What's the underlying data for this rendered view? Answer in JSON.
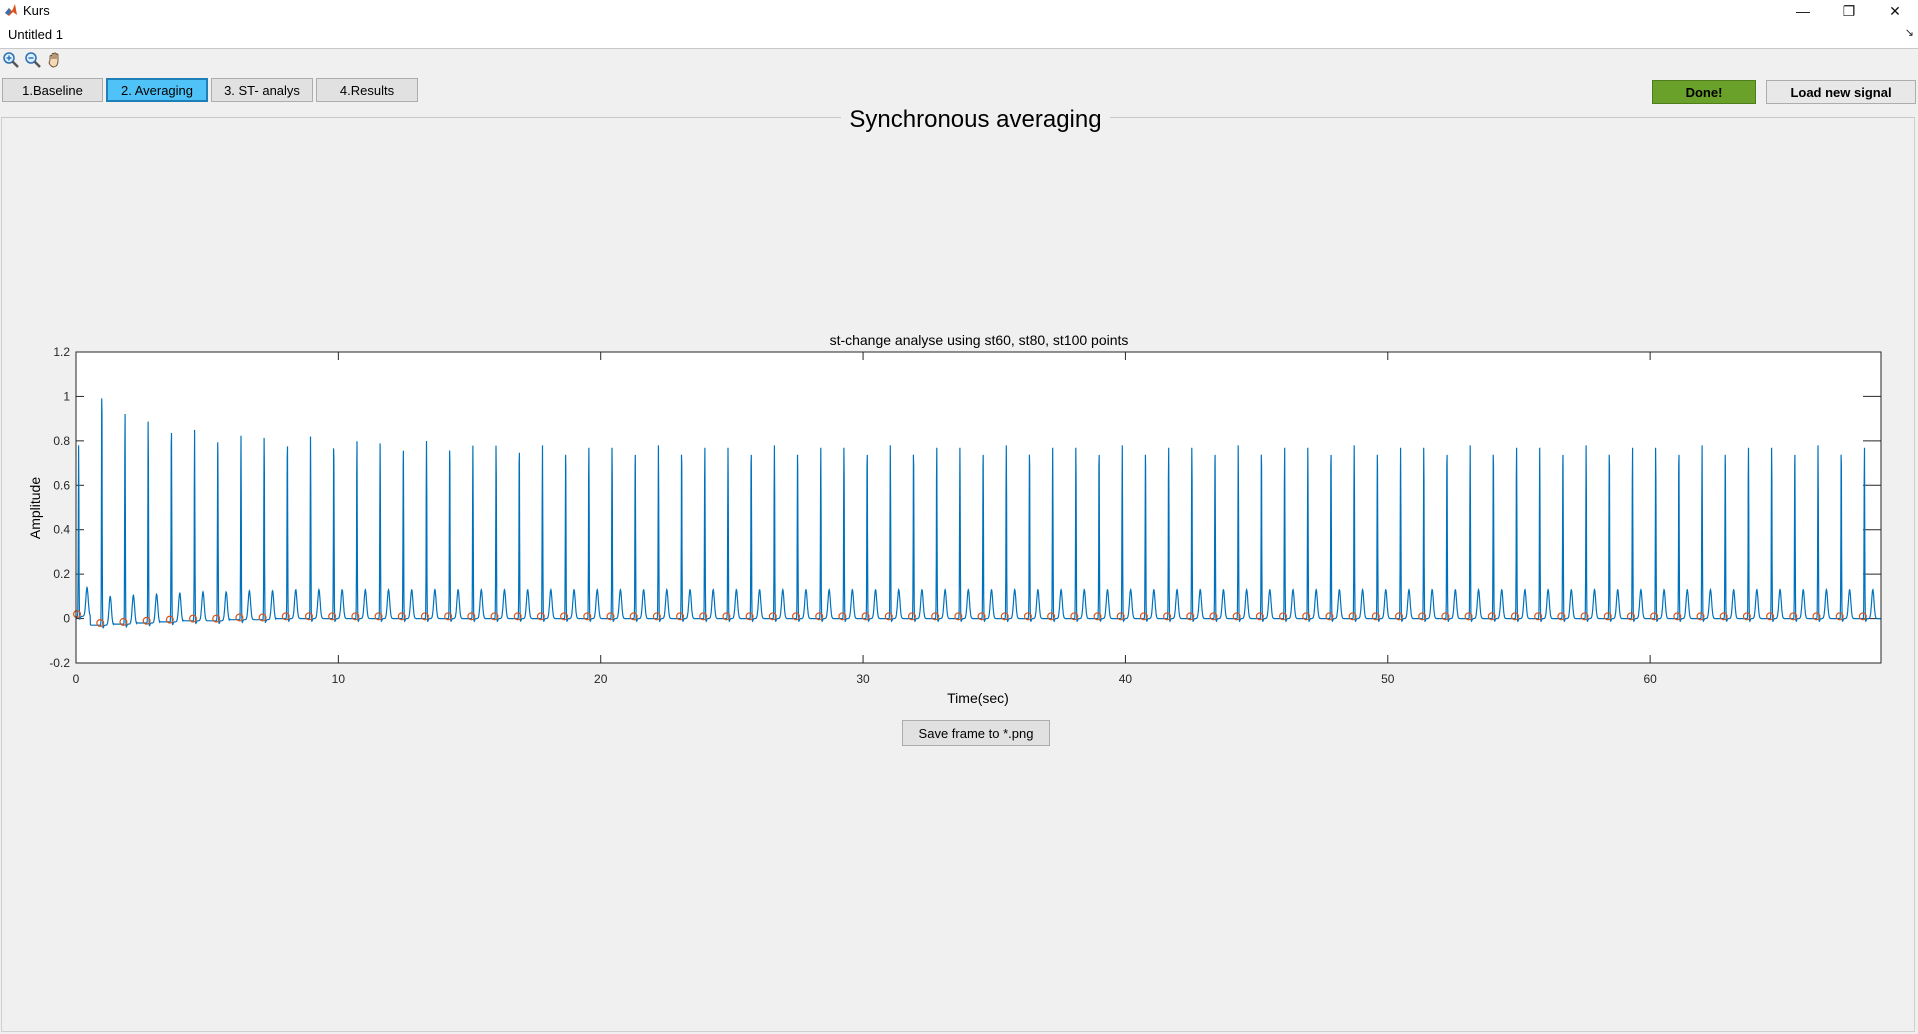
{
  "window": {
    "app_title": "Kurs",
    "document_name": "Untitled 1",
    "minimize_glyph": "—",
    "restore_glyph": "❐",
    "close_glyph": "✕",
    "dock_glyph": "↘"
  },
  "toolbar": {
    "icons": [
      "zoom-in-icon",
      "zoom-out-icon",
      "pan-hand-icon"
    ]
  },
  "tabs": [
    {
      "label": "1.Baseline",
      "active": false
    },
    {
      "label": "2. Averaging",
      "active": true
    },
    {
      "label": "3. ST- analys",
      "active": false
    },
    {
      "label": "4.Results",
      "active": false
    }
  ],
  "actions": {
    "done_label": "Done!",
    "done_color": "#6aa12b",
    "load_label": "Load new signal",
    "save_label": "Save frame to *.png"
  },
  "panel": {
    "title": "Synchronous averaging"
  },
  "chart_data": {
    "type": "line",
    "title": "st-change analyse using st60, st80, st100 points",
    "xlabel": "Time(sec)",
    "ylabel": "Amplitude",
    "xlim": [
      0,
      68.8
    ],
    "ylim": [
      -0.2,
      1.2
    ],
    "xticks": [
      0,
      10,
      20,
      30,
      40,
      50,
      60
    ],
    "yticks": [
      -0.2,
      0,
      0.2,
      0.4,
      0.6,
      0.8,
      1,
      1.2
    ],
    "grid": false,
    "series": [
      {
        "color": "#0072bd",
        "beat_period_sec": 0.884,
        "first_beat_sec": 0.1,
        "r_peaks": [
          0.77,
          1.08,
          0.96,
          0.92,
          0.9,
          0.86,
          0.85,
          0.84,
          0.83,
          0.82,
          0.82,
          0.81,
          0.81,
          0.8,
          0.8,
          0.8,
          0.8,
          0.79,
          0.79,
          0.79
        ],
        "steady_r_peak": 0.78,
        "t_wave_peak": 0.13
      },
      {
        "color": "#d95319",
        "marker": "circle",
        "st_points": [
          0.01,
          -0.03,
          -0.025,
          -0.02,
          -0.015,
          -0.01,
          -0.01,
          -0.005,
          -0.005,
          0
        ],
        "steady_st_point": 0.0
      }
    ]
  }
}
